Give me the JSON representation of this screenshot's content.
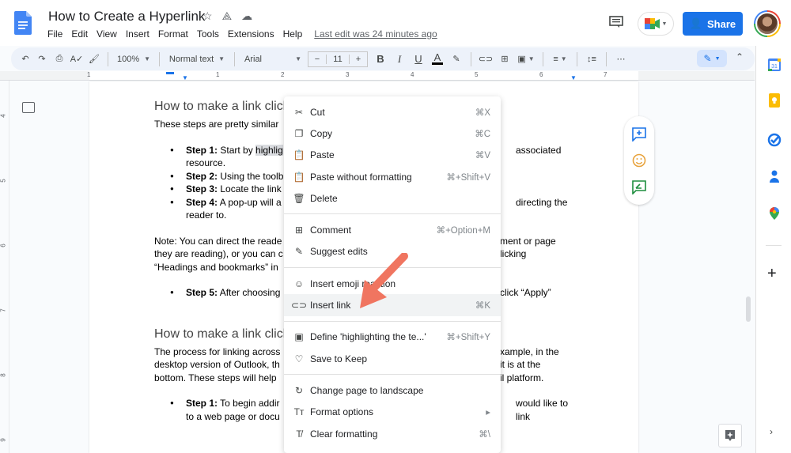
{
  "header": {
    "title": "How to Create a Hyperlink",
    "title_icons": [
      "star-icon",
      "move-to-drive-icon",
      "cloud-saved-icon"
    ],
    "menu": [
      "File",
      "Edit",
      "View",
      "Insert",
      "Format",
      "Tools",
      "Extensions",
      "Help"
    ],
    "last_edit": "Last edit was 24 minutes ago",
    "share_label": "Share"
  },
  "toolbar": {
    "zoom": "100%",
    "style": "Normal text",
    "font": "Arial",
    "font_size": "11",
    "minus": "−",
    "plus": "+",
    "more": "⋯"
  },
  "ruler": {
    "h_numbers": [
      "1",
      "1",
      "2",
      "3",
      "4",
      "5",
      "6",
      "7"
    ],
    "v_numbers": [
      "4",
      "5",
      "6",
      "7",
      "8",
      "9"
    ]
  },
  "document": {
    "heading1": "How to make a link click",
    "intro1": "These steps are pretty similar",
    "steps1": [
      {
        "label": "Step 1:",
        "pre": " Start by ",
        "hl": "highlig",
        "post": "",
        "right": "associated",
        "line2": "resource."
      },
      {
        "label": "Step 2:",
        "pre": " Using the toolb",
        "hl": "",
        "post": "",
        "right": "",
        "line2": ""
      },
      {
        "label": "Step 3:",
        "pre": " Locate the link",
        "hl": "",
        "post": "",
        "right": "",
        "line2": ""
      },
      {
        "label": "Step 4:",
        "pre": " A pop-up will a",
        "hl": "",
        "post": "",
        "right": "directing the",
        "line2": "reader to."
      }
    ],
    "note_lines": [
      {
        "left": "Note: You can direct the reade",
        "right": "ment or page"
      },
      {
        "left": "they are reading), or you can c",
        "right": "licking"
      },
      {
        "left": "“Headings and bookmarks” in",
        "right": ""
      }
    ],
    "step5": {
      "label": "Step 5:",
      "text": " After choosing",
      "right": "click “Apply”"
    },
    "heading2": "How to make a link click",
    "para2": [
      {
        "left": "The process for linking across",
        "right": "xample, in the"
      },
      {
        "left": "desktop version of Outlook, th",
        "right": "it is at the"
      },
      {
        "left": "bottom. These steps will help",
        "right": "il platform."
      }
    ],
    "step1b": {
      "label": "Step 1:",
      "text": " To begin addir",
      "right": "would like to link",
      "line2": "to a web page or docu"
    }
  },
  "context_menu": {
    "groups": [
      [
        {
          "icon": "scissors-icon",
          "glyph": "✂",
          "label": "Cut",
          "shortcut": "⌘X"
        },
        {
          "icon": "copy-icon",
          "glyph": "❐",
          "label": "Copy",
          "shortcut": "⌘C"
        },
        {
          "icon": "paste-icon",
          "glyph": "📋",
          "label": "Paste",
          "shortcut": "⌘V"
        },
        {
          "icon": "paste-plain-icon",
          "glyph": "📋",
          "label": "Paste without formatting",
          "shortcut": "⌘+Shift+V"
        },
        {
          "icon": "trash-icon",
          "glyph": "🗑",
          "label": "Delete",
          "shortcut": ""
        }
      ],
      [
        {
          "icon": "add-comment-icon",
          "glyph": "⊞",
          "label": "Comment",
          "shortcut": "⌘+Option+M"
        },
        {
          "icon": "suggest-edits-icon",
          "glyph": "✎",
          "label": "Suggest edits",
          "shortcut": ""
        }
      ],
      [
        {
          "icon": "emoji-icon",
          "glyph": "☺",
          "label": "Insert emoji reaction",
          "shortcut": ""
        },
        {
          "icon": "link-icon",
          "glyph": "⊂⊃",
          "label": "Insert link",
          "shortcut": "⌘K",
          "active": true
        }
      ],
      [
        {
          "icon": "dictionary-icon",
          "glyph": "▣",
          "label": "Define 'highlighting the te...'",
          "shortcut": "⌘+Shift+Y"
        },
        {
          "icon": "lightbulb-icon",
          "glyph": "♡",
          "label": "Save to Keep",
          "shortcut": ""
        }
      ],
      [
        {
          "icon": "rotate-icon",
          "glyph": "↻",
          "label": "Change page to landscape",
          "shortcut": ""
        },
        {
          "icon": "text-format-icon",
          "glyph": "Tт",
          "label": "Format options",
          "shortcut": "▸"
        },
        {
          "icon": "clear-format-icon",
          "glyph": "T̸",
          "label": "Clear formatting",
          "shortcut": "⌘\\"
        }
      ]
    ]
  },
  "colors": {
    "accent": "#1a73e8",
    "arrow": "#f07560",
    "menu_active": "#f1f3f4",
    "toolbar_bg": "#edf2fa"
  }
}
